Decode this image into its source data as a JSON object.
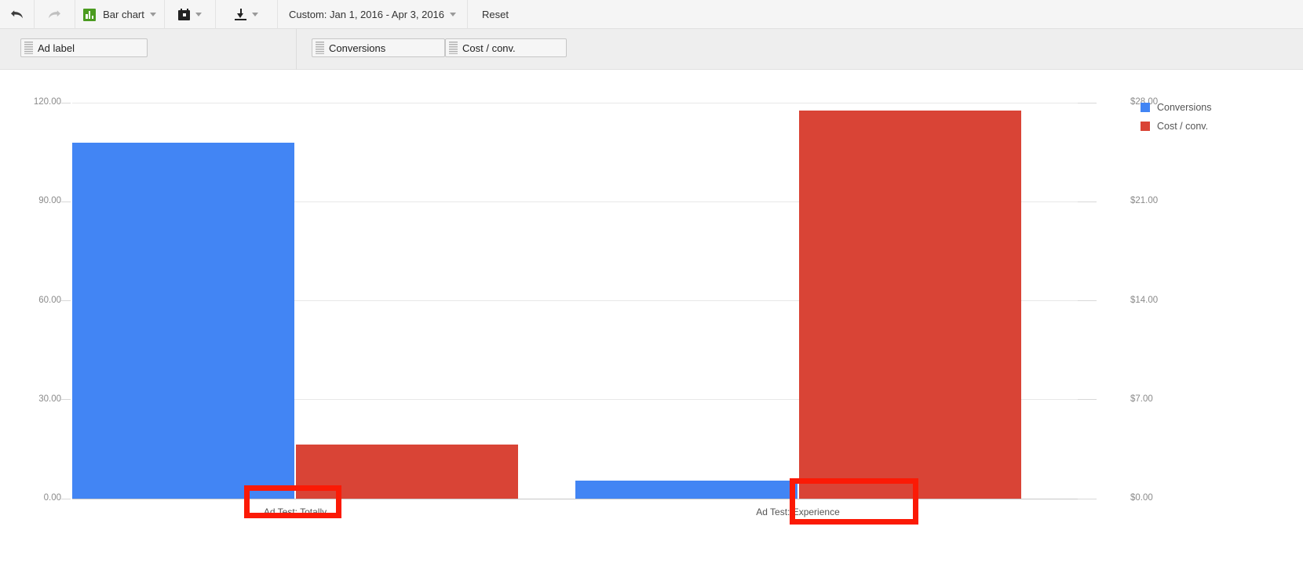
{
  "toolbar": {
    "undo_icon": "undo-icon",
    "redo_icon": "redo-icon",
    "chart_type_label": "Bar chart",
    "chart_type_icon": "bar-chart-icon",
    "date_icon": "calendar-icon",
    "download_icon": "download-icon",
    "date_range_label": "Custom: Jan 1, 2016 - Apr 3, 2016",
    "reset_label": "Reset"
  },
  "chips": {
    "dimension": "Ad label",
    "metric_1": "Conversions",
    "metric_2": "Cost / conv."
  },
  "chart_data": {
    "type": "bar",
    "title": "",
    "xlabel": "",
    "ylabel": "",
    "categories": [
      "Ad Test: Totally",
      "Ad Test: Experience"
    ],
    "series": [
      {
        "name": "Conversions",
        "color": "#4285f4",
        "axis": "left",
        "values": [
          108.0,
          5.5
        ]
      },
      {
        "name": "Cost / conv.",
        "color": "#d94436",
        "axis": "right",
        "values": [
          3.85,
          27.45
        ]
      }
    ],
    "left_axis": {
      "label": "Conversions",
      "ticks": [
        "0.00",
        "30.00",
        "60.00",
        "90.00",
        "120.00"
      ],
      "tick_values": [
        0,
        30,
        60,
        90,
        120
      ],
      "min": 0,
      "max": 120
    },
    "right_axis": {
      "label": "Cost / conv.",
      "ticks": [
        "$0.00",
        "$7.00",
        "$14.00",
        "$21.00",
        "$28.00"
      ],
      "tick_values": [
        0,
        7,
        14,
        21,
        28
      ],
      "min": 0,
      "max": 28
    },
    "legend": [
      {
        "label": "Conversions",
        "color": "#4285f4"
      },
      {
        "label": "Cost / conv.",
        "color": "#d94436"
      }
    ],
    "legend_position": "right",
    "grid": true
  },
  "annotations": {
    "highlight_color": "#fb1a06",
    "boxes": [
      {
        "name": "highlight-ad-test-totally"
      },
      {
        "name": "highlight-ad-test-experience"
      }
    ]
  }
}
